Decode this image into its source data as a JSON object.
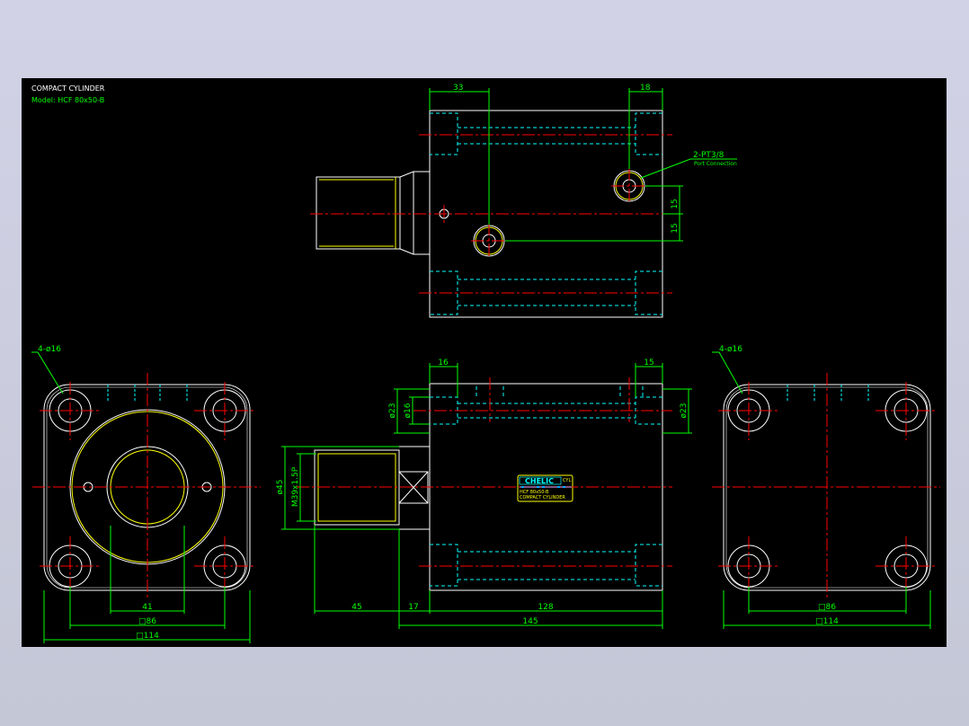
{
  "title": {
    "name": "COMPACT CYLINDER",
    "model": "Model: HCF 80x50-B"
  },
  "colors": {
    "background": "#000000",
    "outline": "#ffffff",
    "center_line": "#ff0000",
    "hidden_line": "#00ffff",
    "dimension": "#00ff00",
    "thread": "#ffff00",
    "frame": "#c8cade"
  },
  "top_view": {
    "dim_left": "33",
    "dim_right": "18",
    "port_callout": "2-PT3/8",
    "port_note": "Port Connection",
    "dim_v1": "15",
    "dim_v2": "15"
  },
  "left_view": {
    "holes": "4-ø16",
    "dim_inner": "41",
    "dim_86": "□86",
    "dim_114": "□114"
  },
  "front_view": {
    "dim_16_left": "16",
    "dim_16_right": "15",
    "phi23_left": "ø23",
    "phi16": "ø16",
    "phi23_right": "ø23",
    "phi45": "ø45",
    "thread": "M39x1.5P",
    "dim_45": "45",
    "dim_17": "17",
    "dim_128": "128",
    "dim_145": "145",
    "label_brand": "CHELIC",
    "label_mark": "CYL",
    "label_model": "HCF 80x50-B",
    "label_name": "COMPACT CYLINDER"
  },
  "right_view": {
    "holes": "4-ø16",
    "dim_86": "□86",
    "dim_114": "□114"
  }
}
